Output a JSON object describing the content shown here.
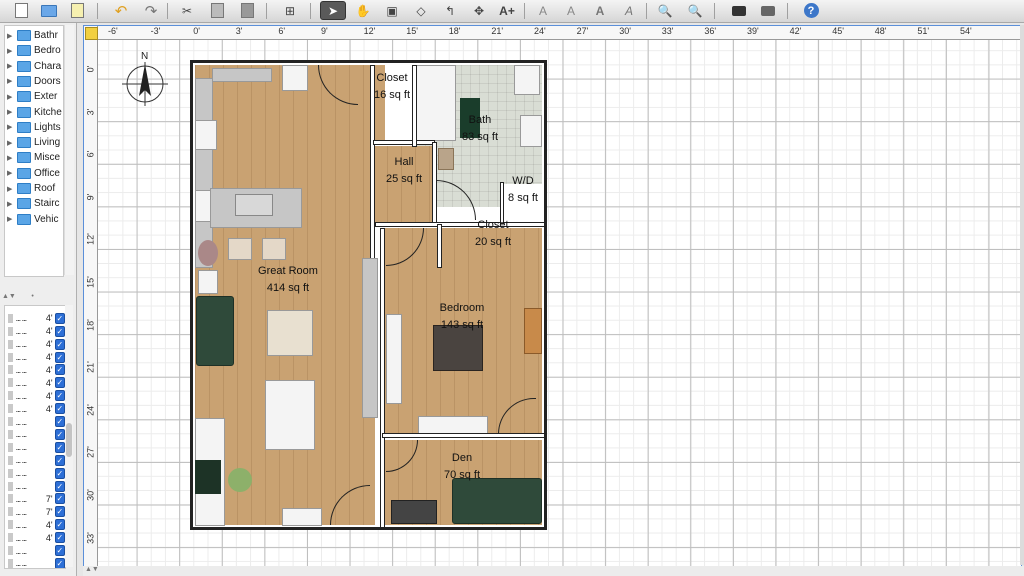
{
  "toolbar": {
    "buttons": [
      {
        "name": "new-home-button",
        "icon": "new-doc-icon"
      },
      {
        "name": "open-button",
        "icon": "folder-icon"
      },
      {
        "name": "save-button",
        "icon": "save-icon"
      },
      {
        "name": "undo-button",
        "icon": "undo-icon"
      },
      {
        "name": "redo-button",
        "icon": "redo-icon"
      },
      {
        "name": "cut-button",
        "icon": "scissors-icon"
      },
      {
        "name": "copy-button",
        "icon": "copy-icon"
      },
      {
        "name": "paste-button",
        "icon": "paste-icon"
      },
      {
        "name": "add-furniture-button",
        "icon": "add-furniture-icon"
      },
      {
        "name": "select-mode-button",
        "icon": "arrow-pointer-icon",
        "active": true
      },
      {
        "name": "pan-mode-button",
        "icon": "hand-icon"
      },
      {
        "name": "create-walls-button",
        "icon": "wall-icon"
      },
      {
        "name": "create-rooms-button",
        "icon": "room-icon"
      },
      {
        "name": "create-polylines-button",
        "icon": "polyline-icon"
      },
      {
        "name": "create-dimensions-button",
        "icon": "dimension-icon"
      },
      {
        "name": "add-text-button",
        "icon": "text-icon"
      },
      {
        "name": "text-style-1-button",
        "icon": "text-style-icon"
      },
      {
        "name": "text-style-2-button",
        "icon": "text-style-icon"
      },
      {
        "name": "text-bold-button",
        "icon": "bold-icon"
      },
      {
        "name": "text-italic-button",
        "icon": "italic-icon"
      },
      {
        "name": "zoom-in-button",
        "icon": "zoom-in-icon"
      },
      {
        "name": "zoom-out-button",
        "icon": "zoom-out-icon"
      },
      {
        "name": "create-photo-button",
        "icon": "camera-icon"
      },
      {
        "name": "create-video-button",
        "icon": "video-icon"
      },
      {
        "name": "help-button",
        "icon": "help-icon"
      }
    ]
  },
  "catalog": {
    "categories": [
      "Bathr",
      "Bedro",
      "Chara",
      "Doors",
      "Exter",
      "Kitche",
      "Lights",
      "Living",
      "Misce",
      "Office",
      "Roof",
      "Stairc",
      "Vehic"
    ]
  },
  "furniture_list": {
    "rows": [
      {
        "name": "... ...",
        "width": "4'",
        "visible": true
      },
      {
        "name": "... ...",
        "width": "4'",
        "visible": true
      },
      {
        "name": "... ...",
        "width": "4'",
        "visible": true
      },
      {
        "name": "... ...",
        "width": "4'",
        "visible": true
      },
      {
        "name": "... ...",
        "width": "4'",
        "visible": true
      },
      {
        "name": "... ...",
        "width": "4'",
        "visible": true
      },
      {
        "name": "... ...",
        "width": "4'",
        "visible": true
      },
      {
        "name": "... ...",
        "width": "4'",
        "visible": true
      },
      {
        "name": "... ...",
        "width": "",
        "visible": true
      },
      {
        "name": "... ...",
        "width": "",
        "visible": true
      },
      {
        "name": "... ...",
        "width": "",
        "visible": true
      },
      {
        "name": "... ...",
        "width": "",
        "visible": true
      },
      {
        "name": "... ...",
        "width": "",
        "visible": true
      },
      {
        "name": "... ...",
        "width": "",
        "visible": true
      },
      {
        "name": "... ...",
        "width": "7'",
        "visible": true
      },
      {
        "name": "... ...",
        "width": "7'",
        "visible": true
      },
      {
        "name": "... ...",
        "width": "4'",
        "visible": true
      },
      {
        "name": "... ...",
        "width": "4'",
        "visible": true
      },
      {
        "name": "... ...",
        "width": "",
        "visible": true
      },
      {
        "name": "... ...",
        "width": "",
        "visible": true
      }
    ]
  },
  "rulers": {
    "top": [
      "-6'",
      "-3'",
      "0'",
      "3'",
      "6'",
      "9'",
      "12'",
      "15'",
      "18'",
      "21'",
      "24'",
      "27'",
      "30'",
      "33'",
      "36'",
      "39'",
      "42'",
      "45'",
      "48'",
      "51'",
      "54'"
    ],
    "left": [
      "0'",
      "3'",
      "6'",
      "9'",
      "12'",
      "15'",
      "18'",
      "21'",
      "24'",
      "27'",
      "30'",
      "33'"
    ]
  },
  "rooms": {
    "closet1": {
      "name": "Closet",
      "area": "16 sq ft"
    },
    "bath": {
      "name": "Bath",
      "area": "83 sq ft"
    },
    "hall": {
      "name": "Hall",
      "area": "25 sq ft"
    },
    "wd": {
      "name": "W/D",
      "area": "8 sq ft"
    },
    "closet2": {
      "name": "Closet",
      "area": "20 sq ft"
    },
    "great_room": {
      "name": "Great Room",
      "area": "414 sq ft"
    },
    "bedroom": {
      "name": "Bedroom",
      "area": "143 sq ft"
    },
    "den": {
      "name": "Den",
      "area": "70 sq ft"
    }
  }
}
